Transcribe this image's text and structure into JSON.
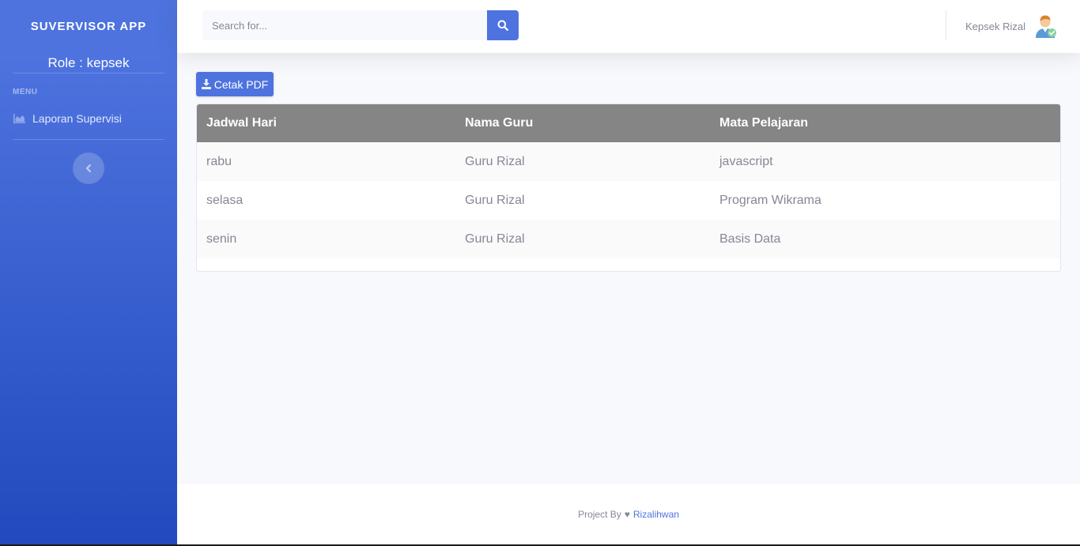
{
  "sidebar": {
    "brand": "SUVERVISOR APP",
    "role": "Role : kepsek",
    "menu_heading": "MENU",
    "items": [
      {
        "label": "Laporan Supervisi",
        "icon": "chart-area-icon"
      }
    ],
    "toggle_icon": "chevron-left-icon"
  },
  "topbar": {
    "search_placeholder": "Search for...",
    "search_icon": "search-icon",
    "user_name": "Kepsek Rizal",
    "avatar_icon": "user-avatar-icon"
  },
  "main": {
    "pdf_button": "Cetak PDF",
    "table": {
      "headers": [
        "Jadwal Hari",
        "Nama Guru",
        "Mata Pelajaran"
      ],
      "rows": [
        [
          "rabu",
          "Guru Rizal",
          "javascript"
        ],
        [
          "selasa",
          "Guru Rizal",
          "Program Wikrama"
        ],
        [
          "senin",
          "Guru Rizal",
          "Basis Data"
        ]
      ]
    }
  },
  "footer": {
    "prefix": "Project By",
    "heart": "♥",
    "author": "Rizalihwan"
  },
  "colors": {
    "primary": "#4e73df",
    "sidebar_bottom": "#224abe",
    "table_header": "#858585",
    "text_muted": "#858796"
  }
}
